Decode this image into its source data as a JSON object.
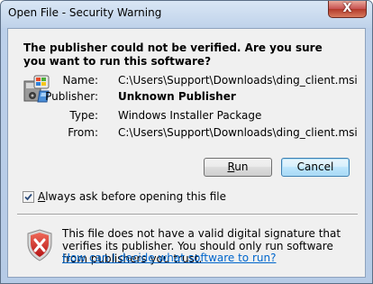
{
  "window": {
    "title": "Open File - Security Warning",
    "close_glyph": "X"
  },
  "heading": "The publisher could not be verified.  Are you sure you want to run this software?",
  "fields": {
    "name_label": "Name:",
    "name_value": "C:\\Users\\Support\\Downloads\\ding_client.msi",
    "publisher_label": "Publisher:",
    "publisher_value": "Unknown Publisher",
    "type_label": "Type:",
    "type_value": "Windows Installer Package",
    "from_label": "From:",
    "from_value": "C:\\Users\\Support\\Downloads\\ding_client.msi"
  },
  "buttons": {
    "run_mnemonic": "R",
    "run_rest": "un",
    "cancel_label": "Cancel"
  },
  "checkbox": {
    "checked": true,
    "label_mnemonic": "A",
    "label_rest": "lways ask before opening this file"
  },
  "warning": {
    "text": "This file does not have a valid digital signature that verifies its publisher.  You should only run software from publishers you trust.",
    "link": "How can I decide what software to run?"
  },
  "icons": {
    "file_icon": "windows-installer-icon",
    "shield_icon": "security-shield-error-icon",
    "close_icon": "close-icon"
  },
  "colors": {
    "link": "#0066cc",
    "shield_red": "#cc2222",
    "default_button_border": "#3c7fb1"
  }
}
